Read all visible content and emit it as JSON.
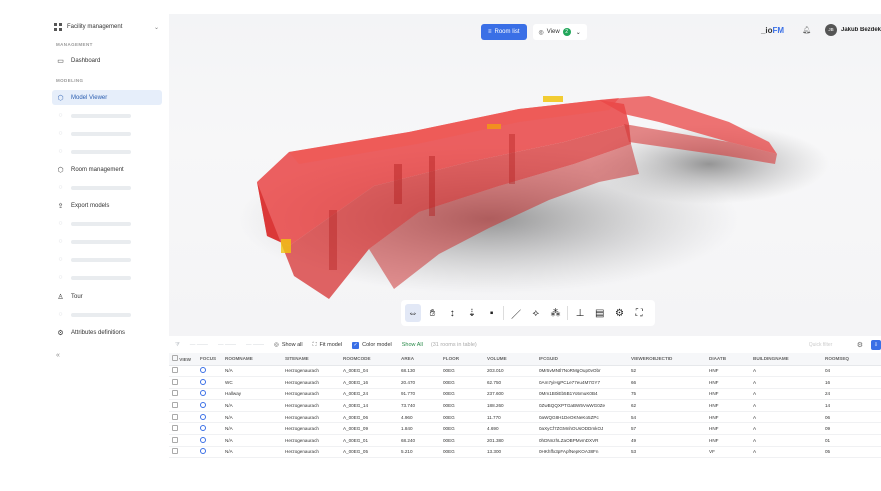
{
  "sidebar": {
    "selector": "Facility management",
    "management_header": "MANAGEMENT",
    "modeling_header": "MODELING",
    "items": {
      "dashboard": "Dashboard",
      "model_viewer": "Model Viewer",
      "room_management": "Room management",
      "export_models": "Export models",
      "tour": "Tour",
      "attributes_definitions": "Attributes definitions"
    }
  },
  "viewer": {
    "room_list_label": "Room list",
    "view_label": "View",
    "view_count": "2",
    "logo_prefix": "_io",
    "logo_suffix": "FM",
    "user_initials": "JB",
    "user_name": "Jakub Bezdeka"
  },
  "table_toolbar": {
    "show_all": "Show all",
    "fit_model": "Fit model",
    "color_model": "Color model",
    "show_all_link": "Show All",
    "meta": "(31 rooms in table)",
    "search_placeholder": "Quick filter"
  },
  "columns": [
    "VIEW",
    "FOCUS",
    "ROOMNAME",
    "SITENAME",
    "ROOMCODE",
    "AREA",
    "FLOOR",
    "VOLUME",
    "IFCGUID",
    "VIEWEROBJECTID",
    "DIAATB",
    "BUILDINGNAME",
    "ROOMSEQ"
  ],
  "rows": [
    [
      "N/A",
      "Herzogenaurach",
      "A_00EG_04",
      "68.130",
      "00EG",
      "203.010",
      "0Mr5vMNtl7NoRMgOup0vObr",
      "52",
      "HNF",
      "A",
      "04"
    ],
    [
      "WC",
      "Herzogenaurach",
      "A_00EG_16",
      "20.470",
      "00EG",
      "62.750",
      "0Am7yiHgPCLe77eu4M7GY7",
      "66",
      "HNF",
      "A",
      "16"
    ],
    [
      "Hallway",
      "Herzogenaurach",
      "A_00EG_24",
      "91.770",
      "00EG",
      "237.600",
      "0Mm1B0iEb5B1Yo5muK0B4",
      "75",
      "HNF",
      "A",
      "24"
    ],
    [
      "N/A",
      "Herzogenaurach",
      "A_00EG_14",
      "73.740",
      "00EG",
      "188.260",
      "0ZwBQQXPTGaBW5VwWG0Ze",
      "62",
      "HNF",
      "A",
      "14"
    ],
    [
      "N/A",
      "Herzogenaurach",
      "A_00EG_06",
      "4.960",
      "00EG",
      "11.770",
      "0aWQG8H1DeOKNeKo5ZPc",
      "54",
      "HNF",
      "A",
      "06"
    ],
    [
      "N/A",
      "Herzogenaurach",
      "A_00EG_09",
      "1.840",
      "00EG",
      "4.690",
      "0aXyCf7ZGMnhOUsODDmkOJ",
      "57",
      "HNF",
      "A",
      "09"
    ],
    [
      "N/A",
      "Herzogenaurach",
      "A_00EG_01",
      "68.240",
      "00EG",
      "201.380",
      "0hDNnzhLZaOBPMvmDXVR",
      "49",
      "HNF",
      "A",
      "01"
    ],
    [
      "N/A",
      "Herzogenaurach",
      "A_00EG_05",
      "5.210",
      "00EG",
      "13.300",
      "0HKhffx3pFApfNepKOA38Fn",
      "53",
      "VF",
      "A",
      "05"
    ]
  ]
}
